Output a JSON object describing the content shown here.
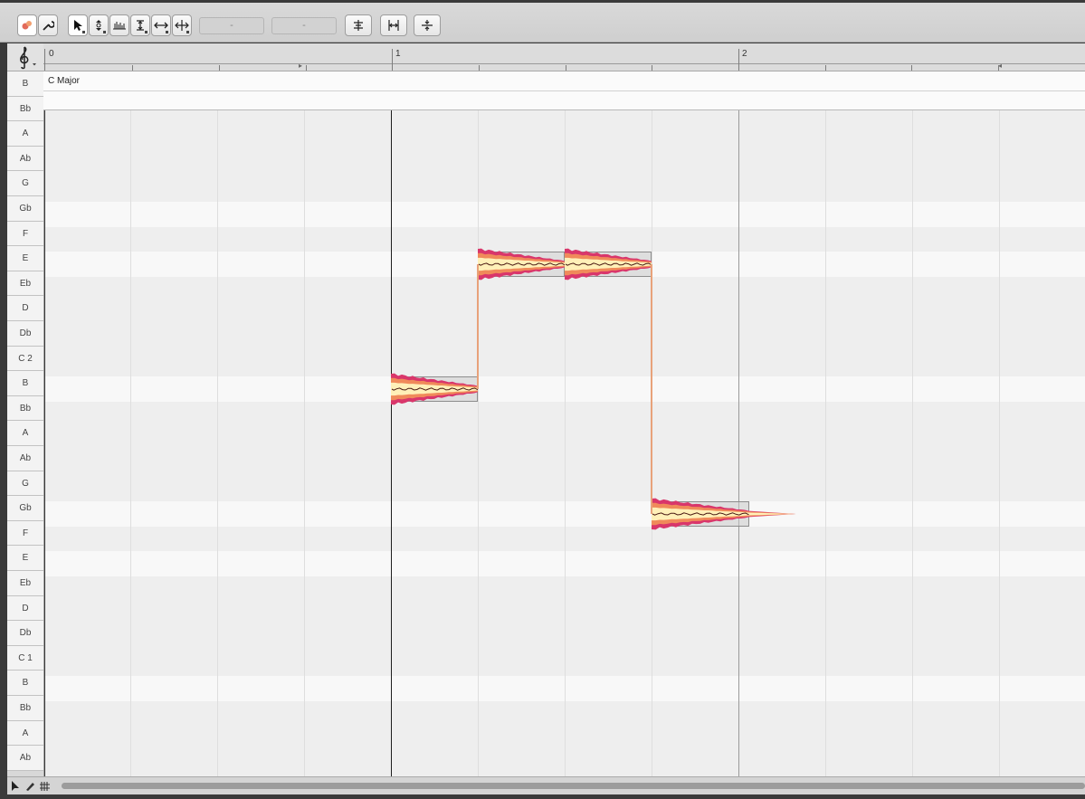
{
  "toolbar": {
    "tools": [
      {
        "name": "main-tool-icon"
      },
      {
        "name": "wrench-icon"
      },
      {
        "name": "pointer-tool-icon"
      },
      {
        "name": "pitch-tool-icon"
      },
      {
        "name": "formant-tool-icon"
      },
      {
        "name": "amplitude-tool-icon"
      },
      {
        "name": "time-tool-icon"
      },
      {
        "name": "separation-tool-icon"
      }
    ],
    "field_1": "-",
    "field_2": "-",
    "actions": [
      {
        "name": "pitch-center-icon"
      },
      {
        "name": "time-quantize-icon"
      },
      {
        "name": "pitch-drift-icon"
      }
    ]
  },
  "clef": {
    "icon": "treble-clef-icon"
  },
  "ruler": {
    "marks": [
      "0",
      "1",
      "2"
    ]
  },
  "key_lane": {
    "label": "C Major"
  },
  "piano_keys": [
    "B",
    "Bb",
    "A",
    "Ab",
    "G",
    "Gb",
    "F",
    "E",
    "Eb",
    "D",
    "Db",
    "C 2",
    "B",
    "Bb",
    "A",
    "Ab",
    "G",
    "Gb",
    "F",
    "E",
    "Eb",
    "D",
    "Db",
    "C 1",
    "B",
    "Bb",
    "A",
    "Ab"
  ],
  "notes": [
    {
      "pitch": "C 2",
      "beat_start": 1.0,
      "beat_end": 1.25
    },
    {
      "pitch": "F",
      "beat_start": 1.25,
      "beat_end": 1.5
    },
    {
      "pitch": "F",
      "beat_start": 1.5,
      "beat_end": 1.75
    },
    {
      "pitch": "G",
      "beat_start": 1.75,
      "beat_end": 2.03
    }
  ],
  "colors": {
    "blob_outer": "#d9366b",
    "blob_mid": "#f08a5a",
    "blob_inner": "#fff0b8",
    "pitch_line": "#4a1a14"
  }
}
